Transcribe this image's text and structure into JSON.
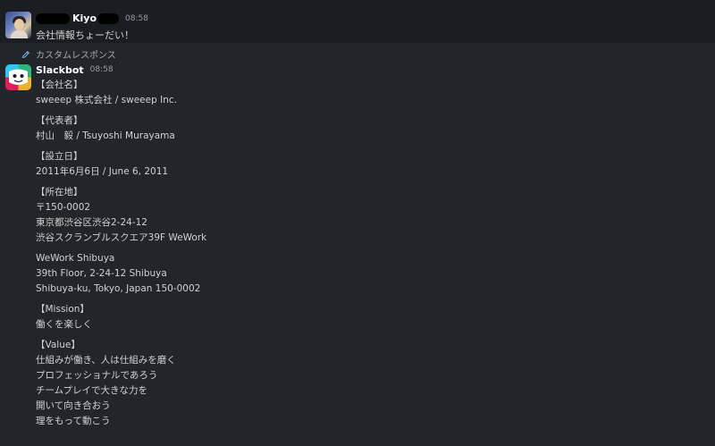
{
  "user_message": {
    "username": "Kiyo",
    "timestamp": "08:58",
    "text": "会社情報ちょーだい！"
  },
  "custom_response_label": "カスタムレスポンス",
  "bot_message": {
    "username": "Slackbot",
    "timestamp": "08:58",
    "sections": [
      {
        "lines": [
          "【会社名】",
          "sweeep 株式会社 / sweeep Inc."
        ]
      },
      {
        "lines": [
          "【代表者】",
          "村山　毅 / Tsuyoshi Murayama"
        ]
      },
      {
        "lines": [
          "【設立日】",
          "2011年6月6日 / June 6, 2011"
        ]
      },
      {
        "lines": [
          "【所在地】",
          "〒150-0002",
          "東京都渋谷区渋谷2-24-12",
          "渋谷スクランブルスクエア39F WeWork"
        ]
      },
      {
        "lines": [
          "WeWork Shibuya",
          "39th Floor, 2-24-12 Shibuya",
          "Shibuya-ku, Tokyo, Japan 150-0002"
        ]
      },
      {
        "lines": [
          "【Mission】",
          "働くを楽しく"
        ]
      },
      {
        "lines": [
          "【Value】",
          "仕組みが働き、人は仕組みを磨く",
          "プロフェッショナルであろう",
          "チームプレイで大きな力を",
          "開いて向き合おう",
          "理をもって動こう"
        ]
      }
    ]
  },
  "colors": {
    "background": "#1a1d21",
    "bot_message_background": "#222529",
    "text": "#d1d2d3",
    "username": "#ffffff",
    "timestamp": "#9a9b9e"
  }
}
